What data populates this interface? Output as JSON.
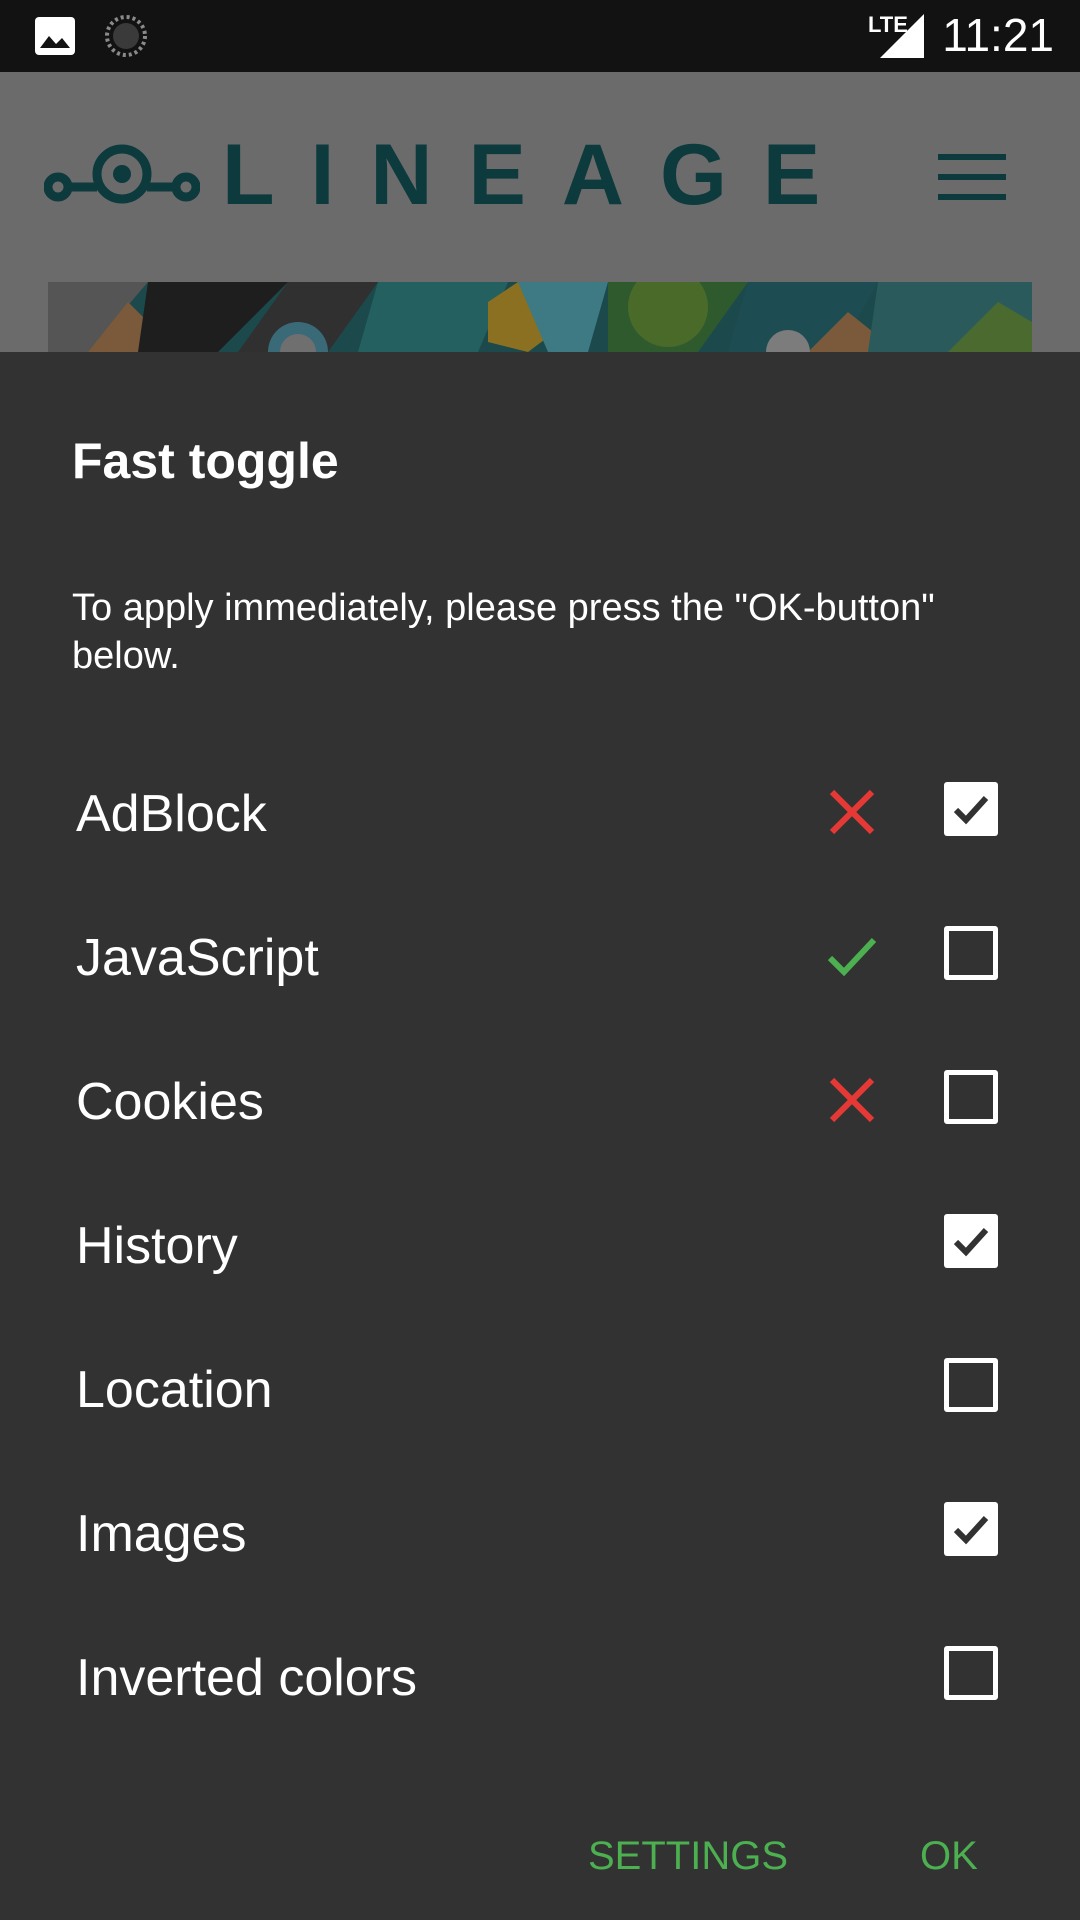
{
  "status_bar": {
    "time": "11:21",
    "network_type": "LTE",
    "left_icons": [
      "image-icon",
      "loading-spinner-icon"
    ]
  },
  "background_page": {
    "logo_text": "LINEAGE",
    "menu_icon": "hamburger-menu-icon"
  },
  "dialog": {
    "title": "Fast toggle",
    "message": "To apply immediately, please press the \"OK-button\" below.",
    "rows": [
      {
        "label": "AdBlock",
        "status": "cross",
        "checked": true
      },
      {
        "label": "JavaScript",
        "status": "check",
        "checked": false
      },
      {
        "label": "Cookies",
        "status": "cross",
        "checked": false
      },
      {
        "label": "History",
        "status": "none",
        "checked": true
      },
      {
        "label": "Location",
        "status": "none",
        "checked": false
      },
      {
        "label": "Images",
        "status": "none",
        "checked": true
      },
      {
        "label": "Inverted colors",
        "status": "none",
        "checked": false
      }
    ],
    "buttons": {
      "settings": "SETTINGS",
      "ok": "OK"
    }
  },
  "colors": {
    "accent": "#4caf50",
    "cross": "#e53935",
    "check": "#4caf50",
    "dialog_bg": "#323232",
    "status_bar_bg": "#121212"
  }
}
